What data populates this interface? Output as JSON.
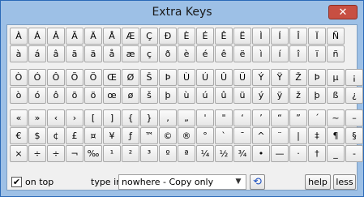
{
  "window": {
    "title": "Extra Keys",
    "close_symbol": "✕"
  },
  "keyboard": {
    "rows": [
      [
        "À",
        "Á",
        "Â",
        "Ã",
        "Ä",
        "Å",
        "Æ",
        "Ç",
        "Ð",
        "È",
        "É",
        "Ê",
        "Ë",
        "Ì",
        "Í",
        "Î",
        "Ï",
        "Ñ"
      ],
      [
        "à",
        "á",
        "â",
        "ã",
        "ä",
        "å",
        "æ",
        "ç",
        "ð",
        "è",
        "é",
        "ê",
        "ë",
        "ì",
        "í",
        "î",
        "ï",
        "ñ"
      ],
      [
        "Ò",
        "Ó",
        "Ô",
        "Õ",
        "Ö",
        "Œ",
        "Ø",
        "Š",
        "Þ",
        "Ù",
        "Ú",
        "Û",
        "Ü",
        "Ý",
        "Ÿ",
        "Ž",
        "Þ",
        "µ",
        "¡"
      ],
      [
        "ò",
        "ó",
        "ô",
        "õ",
        "ö",
        "œ",
        "ø",
        "š",
        "þ",
        "ù",
        "ú",
        "û",
        "ü",
        "ý",
        "ÿ",
        "ž",
        "þ",
        "ß",
        "¿"
      ],
      [
        "«",
        "»",
        "‹",
        "›",
        "[",
        "]",
        "{",
        "}",
        "‚",
        "„",
        "'",
        "\"",
        "‘",
        "’",
        "“",
        "”",
        "´",
        "~",
        "–"
      ],
      [
        "€",
        "$",
        "¢",
        "£",
        "¤",
        "¥",
        "ƒ",
        "™",
        "©",
        "®",
        "°",
        "`",
        "¯",
        "^",
        "¨",
        "|",
        "‡",
        "¶",
        "§"
      ],
      [
        "×",
        "÷",
        "÷",
        "¬",
        "‰",
        "¹",
        "²",
        "³",
        "º",
        "ª",
        "¼",
        "½",
        "¾",
        "•",
        "—",
        "·",
        "†",
        "_",
        "-"
      ]
    ]
  },
  "bottom_bar": {
    "on_top_checked": true,
    "check_mark": "✔",
    "on_top_label": "on top",
    "type_in_label": "type in",
    "type_in_value": "nowhere - Copy only",
    "dropdown_arrow": "▼",
    "refresh_symbol": "⟲",
    "help_label": "help",
    "less_label": "less"
  }
}
